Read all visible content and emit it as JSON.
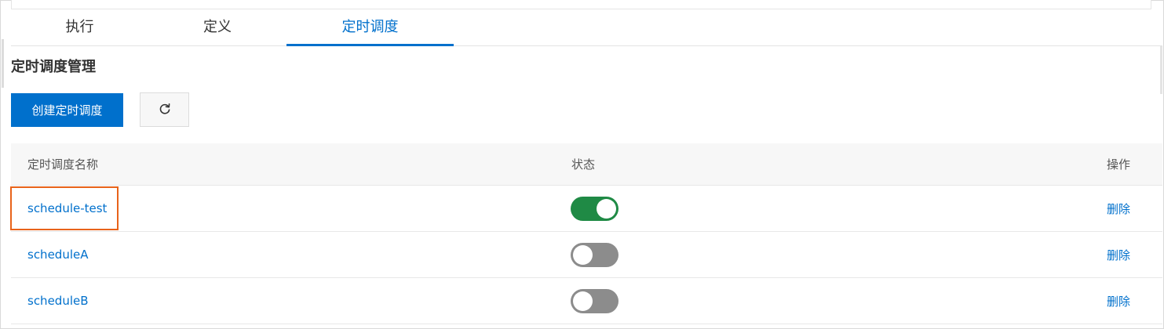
{
  "tabs": [
    {
      "label": "执行",
      "active": false
    },
    {
      "label": "定义",
      "active": false
    },
    {
      "label": "定时调度",
      "active": true
    }
  ],
  "section_title": "定时调度管理",
  "toolbar": {
    "create_label": "创建定时调度",
    "refresh_icon": "refresh-icon"
  },
  "table": {
    "headers": {
      "name": "定时调度名称",
      "status": "状态",
      "action": "操作"
    },
    "rows": [
      {
        "name": "schedule-test",
        "enabled": true,
        "action": "删除"
      },
      {
        "name": "scheduleA",
        "enabled": false,
        "action": "删除"
      },
      {
        "name": "scheduleB",
        "enabled": false,
        "action": "删除"
      }
    ]
  },
  "colors": {
    "accent": "#0070cc",
    "toggle_on": "#1f8a45",
    "toggle_off": "#8c8c8c",
    "highlight": "#e8631a"
  }
}
